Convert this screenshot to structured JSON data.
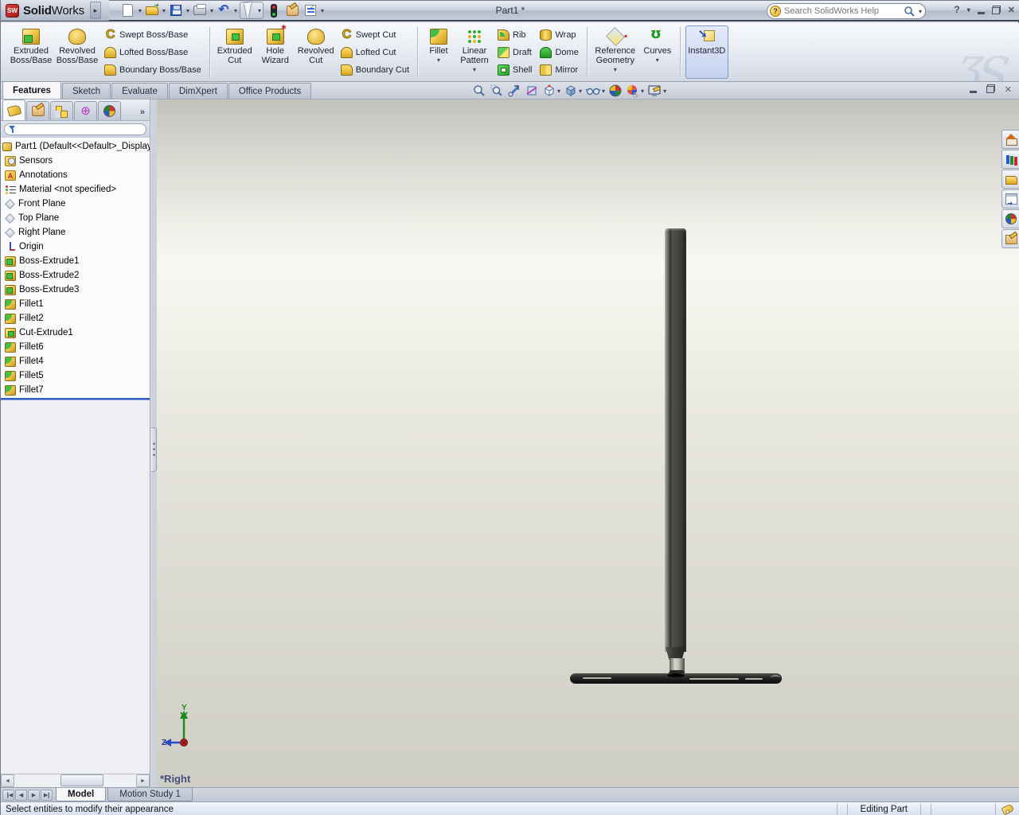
{
  "titlebar": {
    "brand_bold": "Solid",
    "brand_regular": "Works",
    "logo_text": "SW",
    "document_title": "Part1 *",
    "search_placeholder": "Search SolidWorks Help"
  },
  "brand_watermark": "ƷS",
  "ribbon": {
    "extruded_boss": "Extruded Boss/Base",
    "revolved_boss": "Revolved Boss/Base",
    "swept_boss": "Swept Boss/Base",
    "lofted_boss": "Lofted Boss/Base",
    "boundary_boss": "Boundary Boss/Base",
    "extruded_cut": "Extruded Cut",
    "hole_wizard": "Hole Wizard",
    "revolved_cut": "Revolved Cut",
    "swept_cut": "Swept Cut",
    "lofted_cut": "Lofted Cut",
    "boundary_cut": "Boundary Cut",
    "fillet": "Fillet",
    "linear_pattern": "Linear Pattern",
    "rib": "Rib",
    "draft": "Draft",
    "shell": "Shell",
    "wrap": "Wrap",
    "dome": "Dome",
    "mirror": "Mirror",
    "reference_geometry": "Reference Geometry",
    "curves": "Curves",
    "instant3d": "Instant3D"
  },
  "command_tabs": [
    {
      "label": "Features",
      "active": true
    },
    {
      "label": "Sketch",
      "active": false
    },
    {
      "label": "Evaluate",
      "active": false
    },
    {
      "label": "DimXpert",
      "active": false
    },
    {
      "label": "Office Products",
      "active": false
    }
  ],
  "headsup_icons": [
    "zoom-to-fit",
    "zoom-to-area",
    "previous-view",
    "section-view",
    "view-orientation",
    "display-style",
    "hide-show-items",
    "edit-appearance",
    "apply-scene",
    "view-settings"
  ],
  "feature_tree": {
    "root": "Part1  (Default<<Default>_Display",
    "items": [
      {
        "label": "Sensors",
        "icon": "sensors-icon"
      },
      {
        "label": "Annotations",
        "icon": "annotations-icon"
      },
      {
        "label": "Material <not specified>",
        "icon": "material-icon"
      },
      {
        "label": "Front Plane",
        "icon": "plane-icon"
      },
      {
        "label": "Top Plane",
        "icon": "plane-icon"
      },
      {
        "label": "Right Plane",
        "icon": "plane-icon"
      },
      {
        "label": "Origin",
        "icon": "origin-icon"
      },
      {
        "label": "Boss-Extrude1",
        "icon": "boss-extrude-icon"
      },
      {
        "label": "Boss-Extrude2",
        "icon": "boss-extrude-icon"
      },
      {
        "label": "Boss-Extrude3",
        "icon": "boss-extrude-icon"
      },
      {
        "label": "Fillet1",
        "icon": "fillet-icon"
      },
      {
        "label": "Fillet2",
        "icon": "fillet-icon"
      },
      {
        "label": "Cut-Extrude1",
        "icon": "cut-extrude-icon"
      },
      {
        "label": "Fillet6",
        "icon": "fillet-icon"
      },
      {
        "label": "Fillet4",
        "icon": "fillet-icon"
      },
      {
        "label": "Fillet5",
        "icon": "fillet-icon"
      },
      {
        "label": "Fillet7",
        "icon": "fillet-icon"
      }
    ]
  },
  "viewport": {
    "view_label": "*Right",
    "triad_y": "Y",
    "triad_z": "Z",
    "model_colors": {
      "slab_dark": "#3a3a34",
      "neck_light": "#d6d6ce",
      "base_dark": "#18181a"
    }
  },
  "task_pane_icons": [
    "solidworks-resources",
    "design-library",
    "file-explorer",
    "view-palette",
    "appearances-scenes",
    "custom-properties"
  ],
  "bottom_tabs": {
    "model": "Model",
    "motion_study": "Motion Study 1"
  },
  "statusbar": {
    "message": "Select entities to modify their appearance",
    "mode": "Editing Part"
  },
  "colors": {
    "rollback_bar": "#2f5bc4",
    "instant3d_active_bg": "#c6d2ee",
    "titlebar_border": "#3a4150"
  }
}
